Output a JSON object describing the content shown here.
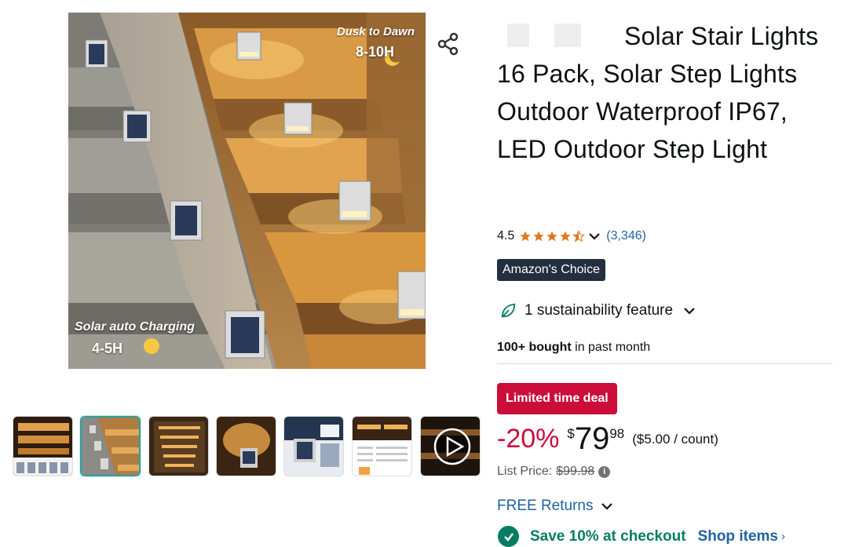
{
  "gallery": {
    "main_image": {
      "caption_top_title": "Dusk to Dawn",
      "caption_top_time": "8-10H",
      "caption_bottom_title": "Solar auto Charging",
      "caption_bottom_time": "4-5H",
      "glow_color": "#f0b048"
    },
    "thumbnails": [
      {
        "id": "thumb-1",
        "selected": false
      },
      {
        "id": "thumb-2",
        "selected": true
      },
      {
        "id": "thumb-3",
        "selected": false
      },
      {
        "id": "thumb-4",
        "selected": false
      },
      {
        "id": "thumb-5",
        "selected": false
      },
      {
        "id": "thumb-6",
        "selected": false
      },
      {
        "id": "thumb-video",
        "selected": false
      }
    ]
  },
  "share_icon": "share-icon",
  "product": {
    "title": "Solar Stair Lights 16 Pack, Solar Step Lights Outdoor Waterproof IP67, LED Outdoor Step Light",
    "rating": "4.5",
    "rating_value": 4.5,
    "review_count": "(3,346)",
    "badge": "Amazon's Choice",
    "sustainability": "1 sustainability feature",
    "bought_bold": "100+ bought",
    "bought_rest": " in past month"
  },
  "pricing": {
    "deal_badge": "Limited time deal",
    "discount": "-20%",
    "currency": "$",
    "price_whole": "79",
    "price_fraction": "98",
    "unit_price": "($5.00 / count)",
    "list_price_label": "List Price:",
    "list_price": "$99.98"
  },
  "delivery": {
    "returns": "FREE Returns",
    "save_text": "Save 10% at checkout",
    "shop_items": "Shop items",
    "shop_chevron": "›"
  },
  "colors": {
    "deal_red": "#cc0c39",
    "link_blue": "#2162a1",
    "badge_navy": "#232f3e",
    "star_orange": "#de7921",
    "save_green": "#067d62",
    "thumb_selected": "#2aa0a4"
  }
}
